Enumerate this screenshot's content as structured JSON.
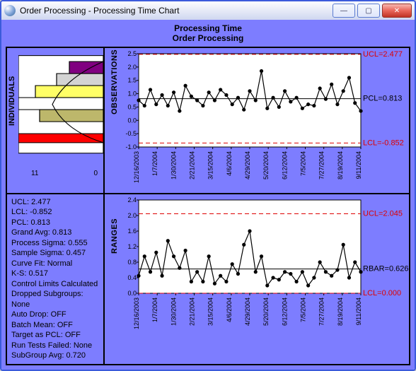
{
  "window": {
    "title": "Order Processing - Processing Time Chart"
  },
  "header": {
    "line1": "Processing Time",
    "line2": "Order Processing"
  },
  "labels": {
    "individuals": "INDIVIDUALS",
    "observations": "OBSERVATIONS",
    "ranges": "RANGES"
  },
  "hist_axis": {
    "left": "11",
    "right": "0"
  },
  "stats": [
    "UCL: 2.477",
    "LCL: -0.852",
    "PCL: 0.813",
    "Grand Avg: 0.813",
    "Process Sigma: 0.555",
    "Sample Sigma: 0.457",
    "Curve Fit: Normal",
    "K-S: 0.517",
    "Control Limits Calculated",
    "Dropped Subgroups: None",
    "Auto Drop: OFF",
    "Batch Mean: OFF",
    "Target as PCL: OFF",
    "Run Tests Failed: None",
    "SubGroup Avg: 0.720"
  ],
  "chart_data": [
    {
      "type": "line",
      "name": "observations",
      "ylim": [
        -1.0,
        2.5
      ],
      "yticks": [
        -1.0,
        -0.5,
        0.0,
        0.5,
        1.0,
        1.5,
        2.0,
        2.5
      ],
      "ucl": 2.477,
      "pcl": 0.813,
      "lcl": -0.852,
      "x": [
        "12/16/2003",
        "1/7/2004",
        "1/30/2004",
        "2/21/2004",
        "3/15/2004",
        "4/6/2004",
        "4/29/2004",
        "5/20/2004",
        "6/12/2004",
        "7/5/2004",
        "7/27/2004",
        "8/19/2004",
        "9/11/2004"
      ],
      "values": [
        0.75,
        0.55,
        1.15,
        0.6,
        0.95,
        0.55,
        1.05,
        0.35,
        1.3,
        0.9,
        0.75,
        0.55,
        1.05,
        0.75,
        1.15,
        0.95,
        0.6,
        0.85,
        0.4,
        1.1,
        0.75,
        1.85,
        0.45,
        0.85,
        0.5,
        1.1,
        0.7,
        0.85,
        0.45,
        0.6,
        0.55,
        1.2,
        0.8,
        1.35,
        0.6,
        1.1,
        1.6,
        0.65,
        0.35
      ]
    },
    {
      "type": "line",
      "name": "ranges",
      "ylim": [
        0.0,
        2.4
      ],
      "yticks": [
        0.0,
        0.4,
        0.8,
        1.2,
        1.6,
        2.0,
        2.4
      ],
      "ucl": 2.045,
      "rbar": 0.626,
      "lcl": 0.0,
      "x": [
        "12/16/2003",
        "1/7/2004",
        "1/30/2004",
        "2/21/2004",
        "3/15/2004",
        "4/6/2004",
        "4/29/2004",
        "5/20/2004",
        "6/12/2004",
        "7/5/2004",
        "7/27/2004",
        "8/19/2004",
        "9/11/2004"
      ],
      "values": [
        0.45,
        0.95,
        0.55,
        1.05,
        0.45,
        1.35,
        0.95,
        0.65,
        1.1,
        0.3,
        0.55,
        0.3,
        0.95,
        0.25,
        0.45,
        0.3,
        0.75,
        0.5,
        1.25,
        1.6,
        0.55,
        0.95,
        0.2,
        0.4,
        0.35,
        0.55,
        0.5,
        0.3,
        0.55,
        0.2,
        0.4,
        0.8,
        0.55,
        0.45,
        0.6,
        1.25,
        0.4,
        0.8,
        0.55
      ]
    }
  ],
  "annotations": {
    "obs": {
      "ucl": "UCL=2.477",
      "pcl": "PCL=0.813",
      "lcl": "LCL=-0.852"
    },
    "range": {
      "ucl": "UCL=2.045",
      "rbar": "RBAR=0.626",
      "lcl": "LCL=0.000"
    }
  }
}
